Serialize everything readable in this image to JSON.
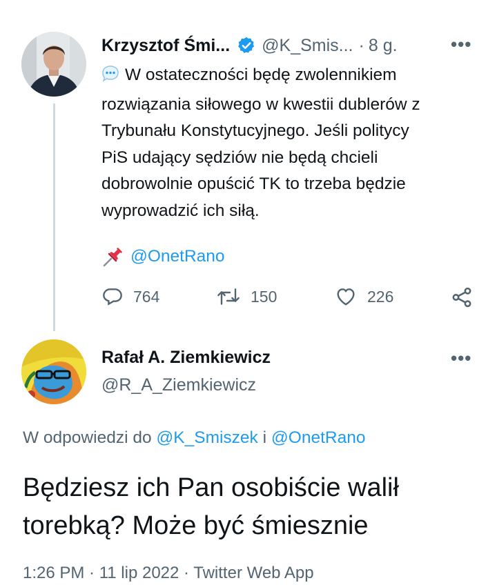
{
  "tweet": {
    "author_name": "Krzysztof Śmi...",
    "author_handle": "@K_Smis...",
    "separator": "·",
    "time": "8 g.",
    "more": "•••",
    "body_lines": [
      "W ostateczności będę zwolennikiem",
      "rozwiązania siłowego w kwestii dublerów z",
      "Trybunału Konstytucyjnego. Jeśli politycy",
      "PiS udający sędziów nie będą chcieli",
      "dobrowolnie opuścić TK to trzeba będzie",
      "wyprowadzić ich siłą."
    ],
    "pin_mention": "@OnetRano",
    "replies": "764",
    "retweets": "150",
    "likes": "226",
    "icons": [
      "speech-balloon-icon",
      "pushpin-icon",
      "verified-badge-icon",
      "reply-icon",
      "retweet-icon",
      "like-icon",
      "share-icon"
    ]
  },
  "reply": {
    "author_name": "Rafał A. Ziemkiewicz",
    "author_handle": "@R_A_Ziemkiewicz",
    "more": "•••",
    "replying_prefix": "W odpowiedzi do",
    "replying_to_1": "@K_Smiszek",
    "replying_join": "i",
    "replying_to_2": "@OnetRano",
    "text_lines": [
      "Będziesz ich Pan osobiście walił",
      "torebką? Może być śmiesznie"
    ],
    "meta": "1:26 PM · 11 lip 2022 · Twitter Web App"
  },
  "colors": {
    "accent": "#1d9bf0",
    "text": "#0f1419",
    "secondary": "#536471",
    "thread_line": "#cfd9de"
  }
}
